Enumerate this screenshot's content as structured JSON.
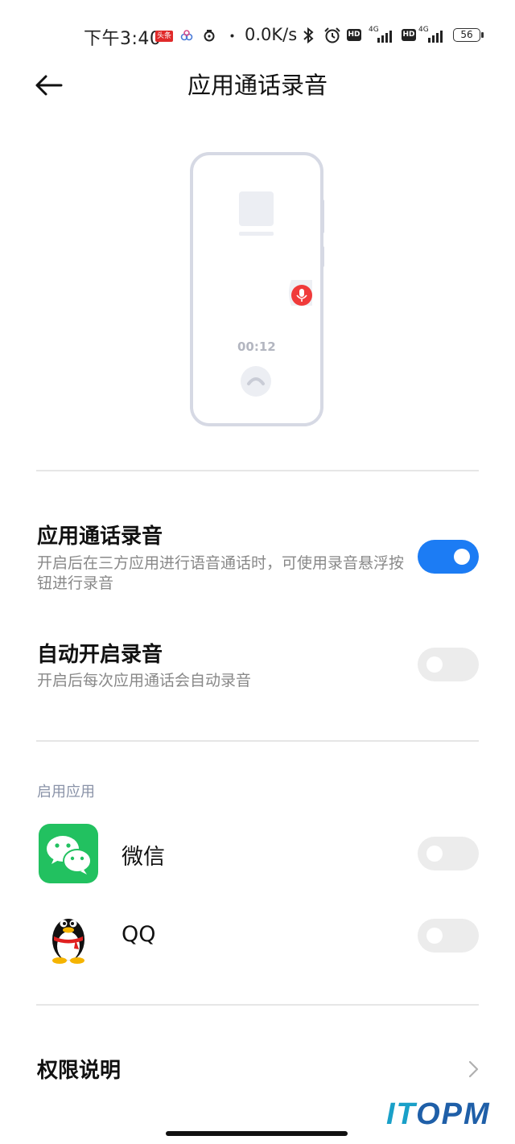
{
  "status_bar": {
    "time": "下午3:40",
    "news_badge": "头条",
    "net_speed": "0.0K/s",
    "hd1": "HD",
    "hd2": "HD",
    "net1": "4G",
    "net2": "4G",
    "battery": "56"
  },
  "header": {
    "back_icon": "arrow-left-icon",
    "title": "应用通话录音"
  },
  "illustration": {
    "timer": "00:12",
    "mic_color": "#f03a3a"
  },
  "settings": [
    {
      "title": "应用通话录音",
      "description": "开启后在三方应用进行语音通话时，可使用录音悬浮按钮进行录音",
      "enabled": true
    },
    {
      "title": "自动开启录音",
      "description": "开启后每次应用通话会自动录音",
      "enabled": false
    }
  ],
  "apps_section": {
    "label": "启用应用",
    "apps": [
      {
        "name": "微信",
        "icon": "wechat-icon",
        "enabled": false
      },
      {
        "name": "QQ",
        "icon": "qq-penguin-icon",
        "enabled": false
      }
    ]
  },
  "permission": {
    "label": "权限说明",
    "icon": "chevron-right-icon"
  },
  "watermark": {
    "text_a": "IT",
    "text_b": "OPM"
  },
  "colors": {
    "accent": "#1c7cf4",
    "wechat_green": "#22c160",
    "toggle_off": "#ececec"
  }
}
